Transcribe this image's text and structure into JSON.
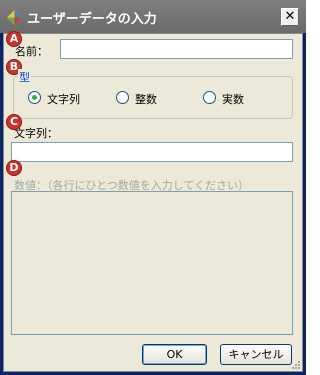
{
  "window": {
    "title": "ユーザーデータの入力",
    "close_glyph": "✕"
  },
  "badges": {
    "a": "A",
    "b": "B",
    "c": "C",
    "d": "D"
  },
  "name_field": {
    "label": "名前：",
    "value": ""
  },
  "type_group": {
    "title": "型",
    "options": [
      {
        "label": "文字列",
        "selected": true
      },
      {
        "label": "整数",
        "selected": false
      },
      {
        "label": "実数",
        "selected": false
      }
    ]
  },
  "string_field": {
    "label": "文字列：",
    "value": ""
  },
  "numeric_field": {
    "label": "数値：（各行にひとつ数値を入力してください）",
    "value": "",
    "enabled": false
  },
  "buttons": {
    "ok": "OK",
    "cancel": "キャンセル"
  },
  "colors": {
    "badge": "#c8332e",
    "radio_selected": "#2db337",
    "group_title": "#0046d5"
  }
}
